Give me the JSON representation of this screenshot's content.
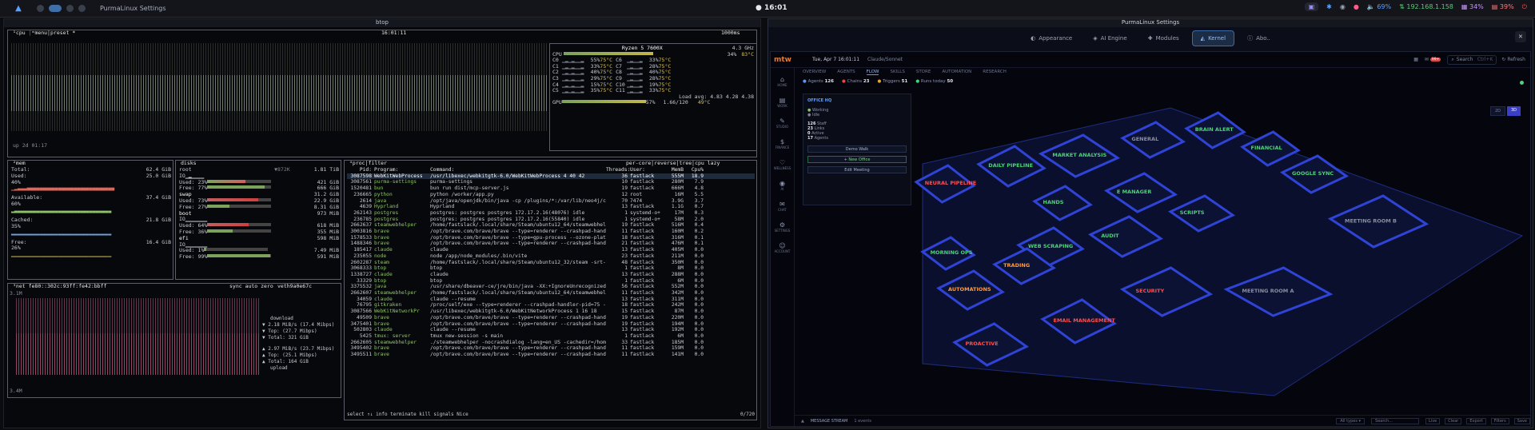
{
  "topbar": {
    "window_title": "PurmaLinux Settings",
    "clock": "16:01",
    "tray": {
      "vol": "69%",
      "ip": "192.168.1.158",
      "cpu": "34%",
      "mem": "39%"
    }
  },
  "btop": {
    "title": "btop",
    "cpu_label": "cpu",
    "menu_label": "menu",
    "preset": "preset *",
    "time": "16:01:11",
    "interval": "1000ms",
    "uptime": "up 2d 01:17",
    "cpu_model": "Ryzen 5 7600X",
    "freq": "4.3 GHz",
    "cpu_rows": [
      {
        "l": "CPU",
        "pct": "34%",
        "t": "83°C"
      },
      {
        "l": "C0",
        "pct": "55%",
        "t": "75°C",
        "l2": "C6",
        "pct2": "33%",
        "t2": "75°C"
      },
      {
        "l": "C1",
        "pct": "33%",
        "t": "75°C",
        "l2": "C7",
        "pct2": "28%",
        "t2": "75°C"
      },
      {
        "l": "C2",
        "pct": "40%",
        "t": "75°C",
        "l2": "C8",
        "pct2": "40%",
        "t2": "75°C"
      },
      {
        "l": "C3",
        "pct": "29%",
        "t": "75°C",
        "l2": "C9",
        "pct2": "28%",
        "t2": "75°C"
      },
      {
        "l": "C4",
        "pct": "15%",
        "t": "75°C",
        "l2": "C10",
        "pct2": "19%",
        "t2": "75°C"
      },
      {
        "l": "C5",
        "pct": "35%",
        "t": "75°C",
        "l2": "C11",
        "pct2": "33%",
        "t2": "75°C"
      }
    ],
    "load_avg": "Load avg: 4.83 4.28 4.38",
    "gpu": {
      "label": "GPU",
      "pct": "57%",
      "mhz": "1.66/120",
      "temp": "49°C"
    },
    "mem": {
      "title": "mem",
      "total": "62.4 GiB",
      "used": "25.0 GiB",
      "used_pct": "40%",
      "available": "37.4 GiB",
      "avail_pct": "60%",
      "cached": "21.8 GiB",
      "cached_pct": "35%",
      "free": "16.4 GiB",
      "free_pct": "26%"
    },
    "disks": {
      "title": "disks",
      "root": {
        "name": "root",
        "size": "1.81 TiB",
        "io": "▼872K",
        "used": "421 GiB",
        "used_pct": "23%",
        "free": "666 GiB",
        "free_pct": "77%"
      },
      "swap": {
        "name": "swap",
        "size": "31.2 GiB",
        "used": "22.9 GiB",
        "used_pct": "73%",
        "free": "8.31 GiB",
        "free_pct": "27%"
      },
      "boot": {
        "name": "boot",
        "size": "973 MiB",
        "used": "618 MiB",
        "used_pct": "64%",
        "free": "355 MiB",
        "free_pct": "36%"
      },
      "efi": {
        "name": "efi",
        "size": "598 MiB",
        "used": "7.49 MiB",
        "used_pct": "1%",
        "free": "591 MiB",
        "free_pct": "99%"
      }
    },
    "net": {
      "title": "net",
      "iface": "fe80::302c:93ff:fe42:bbff",
      "auto": "sync auto zero",
      "dev": "veth9a0e67c",
      "download": "download",
      "dl_rate": "2.18 MiB/s (17.4 Mibps)",
      "dl_top": "(27.7 Mibps)",
      "dl_total": "321 GiB",
      "ul_rate": "2.97 MiB/s (23.7 Mibps)",
      "ul_top": "(25.1 Mibps)",
      "ul_total": "164 GiB",
      "upload": "upload",
      "scale_top": "3.1M",
      "scale_bot": "3.4M"
    },
    "proc": {
      "title": "proc",
      "filter": "filter",
      "cols": [
        "Pid:",
        "Program:",
        "Command:",
        "Threads:",
        "User:",
        "MemB",
        "Cpu%"
      ],
      "rows": [
        [
          "3087598",
          "WebKitWebProcess",
          "/usr/libexec/webkitgtk-6.0/WebKitWebProcess 4 40 42",
          "36",
          "fastlack",
          "555M",
          "18.9"
        ],
        [
          "3087561",
          "purma-settings",
          "purma-settings",
          "10",
          "fastlack",
          "280M",
          "7.9"
        ],
        [
          "1520481",
          "bun",
          "bun run dist/mcp-server.js",
          "19",
          "fastlack",
          "666M",
          "4.8"
        ],
        [
          "236665",
          "python",
          "python /worker/app.py",
          "12",
          "root",
          "16M",
          "5.5"
        ],
        [
          "2614",
          "java",
          "/opt/java/openjdk/bin/java -cp /plugins/*:/var/lib/neo4j/conf/*:/v",
          "70",
          "7474",
          "3.9G",
          "3.7"
        ],
        [
          "4639",
          "Hyprland",
          "Hyprland",
          "13",
          "fastlack",
          "1.1G",
          "0.7"
        ],
        [
          "262143",
          "postgres",
          "postgres: postgres postgres 172.17.2.16(48076) idle",
          "1",
          "systemd-o+",
          "17M",
          "0.3"
        ],
        [
          "236785",
          "postgres",
          "postgres: postgres postgres 172.17.2.16(55840) idle",
          "1",
          "systemd-o+",
          "58M",
          "2.0"
        ],
        [
          "2662637",
          "steamwebhelper",
          "/home/fastslack/.local/share/Steam/ubuntu12_64/steamwebhelper -ty",
          "19",
          "fastlack",
          "516M",
          "0.4"
        ],
        [
          "3003816",
          "brave",
          "/opt/brave.com/brave/brave --type=renderer --crashpad-handler-pid=",
          "11",
          "fastlack",
          "160M",
          "0.2"
        ],
        [
          "1578533",
          "brave",
          "/opt/brave.com/brave/brave --type=gpu-process --ozone-platform=way",
          "18",
          "fastlack",
          "316M",
          "0.1"
        ],
        [
          "1488346",
          "brave",
          "/opt/brave.com/brave/brave --type=renderer --crashpad-handler-pid=",
          "21",
          "fastlack",
          "476M",
          "0.1"
        ],
        [
          "185417",
          "claude",
          "claude",
          "13",
          "fastlack",
          "405M",
          "0.0"
        ],
        [
          "235055",
          "node",
          "node /app/node_modules/.bin/vite",
          "23",
          "fastlack",
          "211M",
          "0.0"
        ],
        [
          "2602287",
          "steam",
          "/home/fastslack/.local/share/Steam/ubuntu12_32/steam -srt-logger-o",
          "48",
          "fastlack",
          "350M",
          "0.0"
        ],
        [
          "3068333",
          "btop",
          "btop",
          "1",
          "fastlack",
          "8M",
          "0.0"
        ],
        [
          "1338727",
          "claude",
          "claude",
          "13",
          "fastlack",
          "288M",
          "0.0"
        ],
        [
          "33329",
          "btop",
          "btop",
          "1",
          "fastlack",
          "6M",
          "0.0"
        ],
        [
          "3375532",
          "java",
          "/usr/share/dbeaver-ce/jre/bin/java -XX:+IgnoreUnrecognizedVMOption",
          "56",
          "fastlack",
          "552M",
          "0.0"
        ],
        [
          "2662607",
          "steamwebhelper",
          "/home/fastslack/.local/share/Steam/ubuntu12_64/steamwebhelper -ty",
          "11",
          "fastlack",
          "342M",
          "0.0"
        ],
        [
          "34059",
          "claude",
          "claude --resume",
          "13",
          "fastlack",
          "311M",
          "0.0"
        ],
        [
          "76795",
          "gitkraken",
          "/proc/self/exe --type=renderer --crashpad-handler-pid=75 --enable-",
          "18",
          "fastlack",
          "242M",
          "0.0"
        ],
        [
          "3087566",
          "WebKitNetworkPr",
          "/usr/libexec/webkitgtk-6.0/WebKitNetworkProcess 1 16 18",
          "15",
          "fastlack",
          "87M",
          "0.0"
        ],
        [
          "49509",
          "brave",
          "/opt/brave.com/brave/brave --type=renderer --crashpad-handler-pid=",
          "19",
          "fastlack",
          "220M",
          "0.0"
        ],
        [
          "3475401",
          "brave",
          "/opt/brave.com/brave/brave --type=renderer --crashpad-handler-pid=",
          "19",
          "fastlack",
          "194M",
          "0.0"
        ],
        [
          "502803",
          "claude",
          "claude --resume",
          "13",
          "fastlack",
          "192M",
          "0.0"
        ],
        [
          "5425",
          "tmux: server",
          "tmux new-session -s main",
          "1",
          "fastlack",
          "6M",
          "0.0"
        ],
        [
          "2662605",
          "steamwebhelper",
          "./steamwebhelper -nocrashdialog -lang=en_US -cachedir=/home/fastsl",
          "33",
          "fastlack",
          "185M",
          "0.0"
        ],
        [
          "3495402",
          "brave",
          "/opt/brave.com/brave/brave --type=renderer --crashpad-handler-pid=",
          "11",
          "fastlack",
          "159M",
          "0.0"
        ],
        [
          "3495511",
          "brave",
          "/opt/brave.com/brave/brave --type=renderer --crashpad-handler-pid=",
          "11",
          "fastlack",
          "141M",
          "0.0"
        ]
      ],
      "footer": "select ↑↓ info terminate kill signals Nice",
      "count": "0/720"
    }
  },
  "settings": {
    "title": "PurmaLinux Settings",
    "tabs": [
      {
        "label": "Appearance",
        "icon": "palette-icon"
      },
      {
        "label": "AI Engine",
        "icon": "ai-icon"
      },
      {
        "label": "Modules",
        "icon": "puzzle-icon"
      },
      {
        "label": "Kernel",
        "icon": "kernel-icon",
        "active": true
      },
      {
        "label": "Abo..",
        "icon": "info-icon"
      }
    ],
    "app": {
      "brand": "mtw",
      "date": "Tue, Apr 7 16:01:11",
      "mode": "Claude/Sonnet",
      "search_placeholder": "Search",
      "search_shortcut": "Ctrl+K",
      "refresh": "Refresh",
      "badge": "99+",
      "nav": [
        "OVERVIEW",
        "AGENTS",
        "FLOW",
        "SKILLS",
        "STORE",
        "AUTOMATION",
        "RESEARCH"
      ],
      "nav_active": "FLOW",
      "stats": [
        {
          "label": "Agents",
          "value": "126"
        },
        {
          "label": "Chains",
          "value": "23"
        },
        {
          "label": "Triggers",
          "value": "51"
        },
        {
          "label": "Runs today",
          "value": "50"
        }
      ],
      "side": [
        "HOME",
        "WORK",
        "STUDIO",
        "FINANCE",
        "WELLNESS",
        "AI",
        "CHAT",
        "SETTINGS",
        "ACCOUNT"
      ],
      "office": {
        "title": "OFFICE HQ",
        "working": "Working",
        "idle": "Idle",
        "s1": "126",
        "s1l": "Staff",
        "s2": "23",
        "s2l": "Links",
        "s3": "0",
        "s3l": "Active",
        "s4": "17",
        "s4l": "Agents",
        "btn1": "Demo Walk",
        "btn2": "+ New Office",
        "btn3": "Edit Meeting"
      },
      "view_2d": "2D",
      "view_3d": "3D",
      "rooms": [
        {
          "name": "NEURAL PIPELINE",
          "color": "#ff4d4d"
        },
        {
          "name": "DAILY PIPELINE",
          "color": "#4dd27a"
        },
        {
          "name": "MARKET ANALYSIS",
          "color": "#4dd27a"
        },
        {
          "name": "GENERAL",
          "color": "#8a8fa0"
        },
        {
          "name": "BRAIN ALERT",
          "color": "#4dd27a"
        },
        {
          "name": "FINANCIAL",
          "color": "#4dd27a"
        },
        {
          "name": "GOOGLE SYNC",
          "color": "#4dd27a"
        },
        {
          "name": "HANDS",
          "color": "#4dd27a"
        },
        {
          "name": "E MANAGER",
          "color": "#4dd27a"
        },
        {
          "name": "SCRIPTS",
          "color": "#4dd27a"
        },
        {
          "name": "WEB SCRAPING",
          "color": "#4dd27a"
        },
        {
          "name": "AUDIT",
          "color": "#4dd27a"
        },
        {
          "name": "TRADING",
          "color": "#ff9a3d"
        },
        {
          "name": "MORNING OPS",
          "color": "#4dd27a"
        },
        {
          "name": "AUTOMATIONS",
          "color": "#ff9a3d"
        },
        {
          "name": "SECURITY",
          "color": "#ff4d4d"
        },
        {
          "name": "EMAIL MANAGEMENT",
          "color": "#ff4d4d"
        },
        {
          "name": "PROACTIVE",
          "color": "#ff4d4d"
        },
        {
          "name": "MEETING ROOM B",
          "color": "#8a8fa0"
        },
        {
          "name": "MEETING ROOM A",
          "color": "#8a8fa0"
        }
      ],
      "msg_stream": "MESSAGE STREAM",
      "msg_count": "1 events",
      "all_types": "All types",
      "search2": "Search...",
      "bottom_btns": [
        "Live",
        "Clear",
        "Export",
        "Filters",
        "Save"
      ],
      "colors": {
        "accent": "#5e93ff",
        "brand": "#e07b3a",
        "floor": "#1b2a6e"
      }
    }
  }
}
